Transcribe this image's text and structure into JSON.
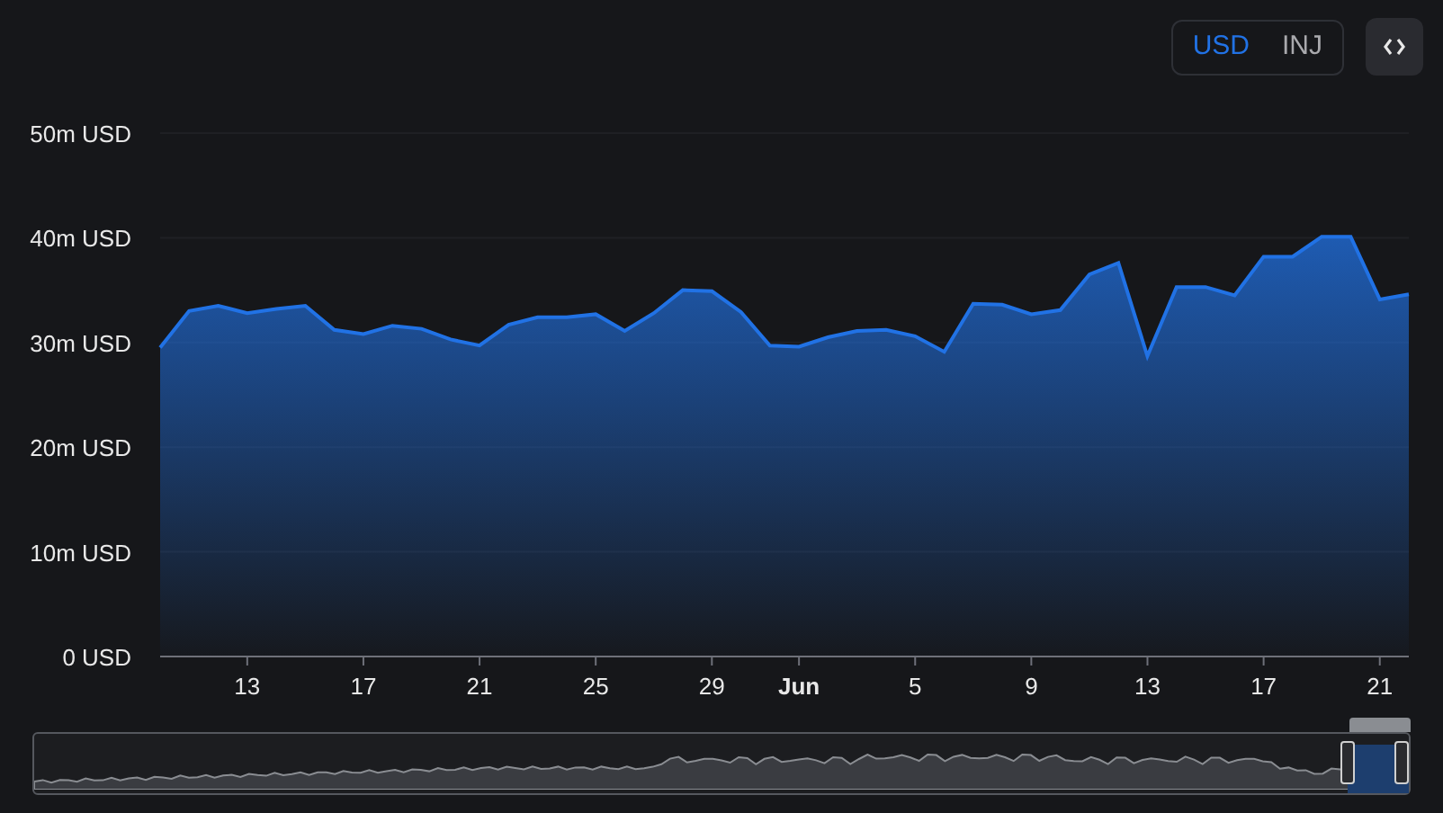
{
  "currency_toggle": [
    {
      "label": "USD",
      "selected": true
    },
    {
      "label": "INJ",
      "selected": false
    }
  ],
  "chart": {
    "chart_data": {
      "type": "area",
      "categories": [
        null,
        null,
        null,
        "13",
        null,
        null,
        null,
        "17",
        null,
        null,
        null,
        "21",
        null,
        null,
        null,
        "25",
        null,
        null,
        null,
        "29",
        null,
        null,
        "Jun",
        null,
        null,
        null,
        "5",
        null,
        null,
        null,
        "9",
        null,
        null,
        null,
        "13",
        null,
        null,
        null,
        "17",
        null,
        null,
        null,
        "21",
        null
      ],
      "series": [
        {
          "color": "#2172e5",
          "values": [
            29.5,
            33,
            33.5,
            32.8,
            33.2,
            33.5,
            31.2,
            30.8,
            31.6,
            31.3,
            30.3,
            29.7,
            31.7,
            32.4,
            32.4,
            32.7,
            31.1,
            32.8,
            35,
            34.9,
            32.9,
            29.7,
            29.6,
            30.5,
            31.1,
            31.2,
            30.6,
            29.1,
            33.7,
            33.6,
            32.7,
            33.1,
            36.5,
            37.6,
            28.7,
            35.3,
            35.3,
            34.5,
            38.2,
            38.2,
            40.1,
            40.1,
            34.1,
            34.6
          ]
        }
      ],
      "ylim": [
        0,
        50
      ],
      "grid": true,
      "yticks": [
        {
          "value": 0,
          "label": "0 USD"
        },
        {
          "value": 10,
          "label": "10m USD"
        },
        {
          "value": 20,
          "label": "20m USD"
        },
        {
          "value": 30,
          "label": "30m USD"
        },
        {
          "value": 40,
          "label": "40m USD"
        },
        {
          "value": 50,
          "label": "50m USD"
        }
      ]
    }
  },
  "range_slider": {
    "level": 0.045
  }
}
